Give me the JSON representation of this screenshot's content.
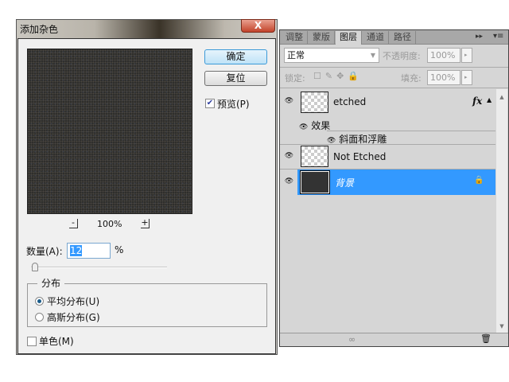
{
  "dialog": {
    "title": "添加杂色",
    "close_label": "X",
    "ok_label": "确定",
    "reset_label": "复位",
    "preview_label": "预览(P)",
    "preview_checked": true,
    "zoom_out": "-",
    "zoom_level": "100%",
    "zoom_in": "+",
    "amount_label": "数量(A):",
    "amount_value": "12",
    "amount_unit": "%",
    "amount_slider_percent": 12,
    "distribution_label": "分布",
    "uniform_label": "平均分布(U)",
    "gaussian_label": "高斯分布(G)",
    "selected": "uniform",
    "mono_label": "单色(M)",
    "mono_checked": false
  },
  "panel": {
    "tabs": [
      "调整",
      "蒙版",
      "图层",
      "通道",
      "路径"
    ],
    "active_tab": "图层",
    "menu_icons": "▸▸",
    "menu": "▾≡",
    "blend_mode": "正常",
    "opacity_label": "不透明度:",
    "opacity": "100%",
    "lock_label": "锁定:",
    "fill_label": "填充:",
    "fill": "100%",
    "layers": [
      {
        "name": "etched",
        "fx": "fx"
      },
      {
        "name": "Not Etched"
      },
      {
        "name": "背景",
        "selected": true
      }
    ],
    "effects_label": "效果",
    "effect_item": "斜面和浮雕",
    "selected_color": "#3399ff"
  }
}
